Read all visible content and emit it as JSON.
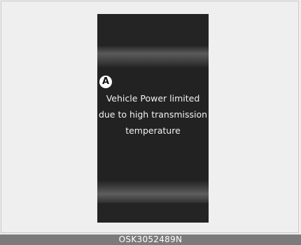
{
  "display": {
    "callout_label": "A",
    "message_lines": [
      "Vehicle Power limited",
      "due to high transmission",
      "temperature"
    ]
  },
  "caption": {
    "code": "OSK3052489N"
  },
  "colors": {
    "background": "#eeeeee",
    "screen": "#242424",
    "text": "#f2f2f2",
    "caption_bar": "#7b7b7b"
  }
}
